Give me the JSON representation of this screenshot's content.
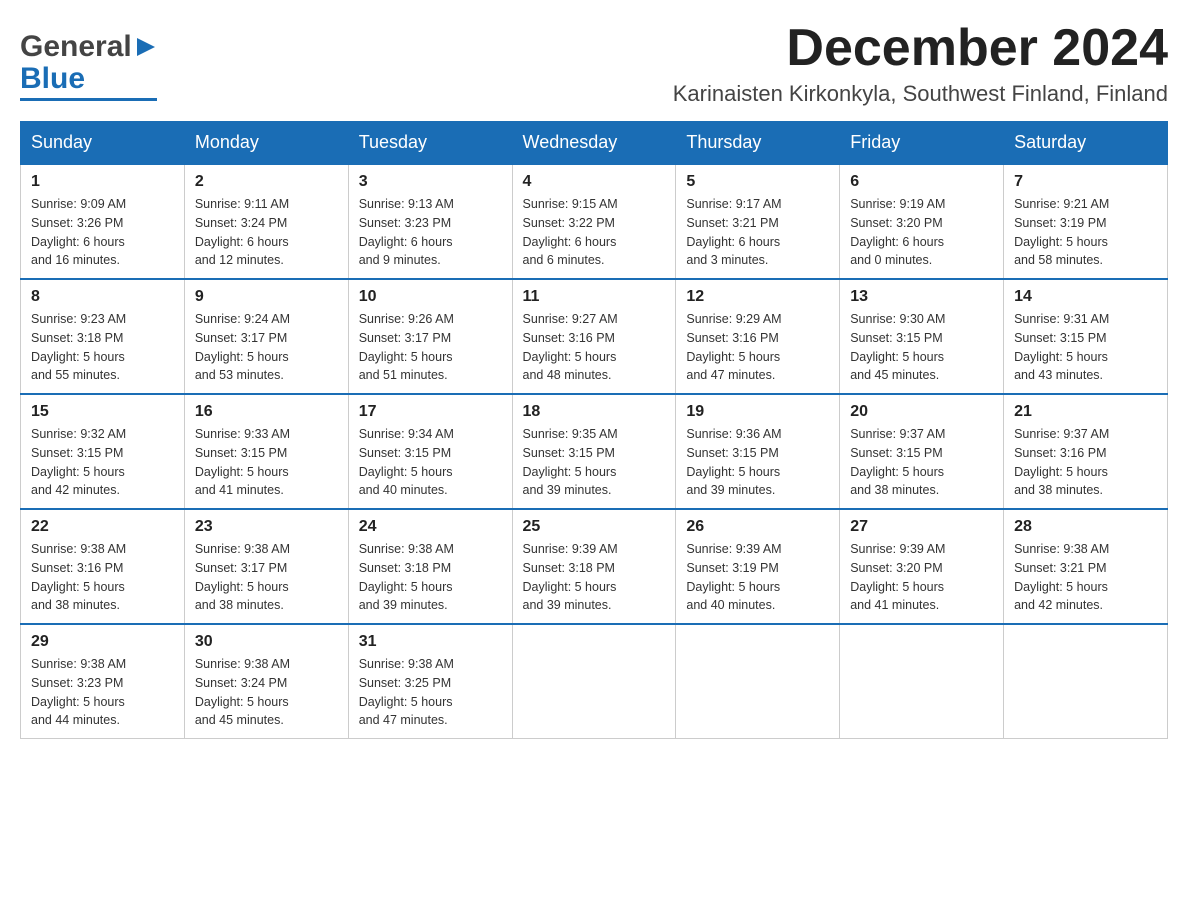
{
  "logo": {
    "general": "General",
    "blue": "Blue"
  },
  "title": "December 2024",
  "subtitle": "Karinaisten Kirkonkyla, Southwest Finland, Finland",
  "headers": [
    "Sunday",
    "Monday",
    "Tuesday",
    "Wednesday",
    "Thursday",
    "Friday",
    "Saturday"
  ],
  "weeks": [
    [
      {
        "day": "1",
        "sunrise": "Sunrise: 9:09 AM",
        "sunset": "Sunset: 3:26 PM",
        "daylight": "Daylight: 6 hours",
        "minutes": "and 16 minutes."
      },
      {
        "day": "2",
        "sunrise": "Sunrise: 9:11 AM",
        "sunset": "Sunset: 3:24 PM",
        "daylight": "Daylight: 6 hours",
        "minutes": "and 12 minutes."
      },
      {
        "day": "3",
        "sunrise": "Sunrise: 9:13 AM",
        "sunset": "Sunset: 3:23 PM",
        "daylight": "Daylight: 6 hours",
        "minutes": "and 9 minutes."
      },
      {
        "day": "4",
        "sunrise": "Sunrise: 9:15 AM",
        "sunset": "Sunset: 3:22 PM",
        "daylight": "Daylight: 6 hours",
        "minutes": "and 6 minutes."
      },
      {
        "day": "5",
        "sunrise": "Sunrise: 9:17 AM",
        "sunset": "Sunset: 3:21 PM",
        "daylight": "Daylight: 6 hours",
        "minutes": "and 3 minutes."
      },
      {
        "day": "6",
        "sunrise": "Sunrise: 9:19 AM",
        "sunset": "Sunset: 3:20 PM",
        "daylight": "Daylight: 6 hours",
        "minutes": "and 0 minutes."
      },
      {
        "day": "7",
        "sunrise": "Sunrise: 9:21 AM",
        "sunset": "Sunset: 3:19 PM",
        "daylight": "Daylight: 5 hours",
        "minutes": "and 58 minutes."
      }
    ],
    [
      {
        "day": "8",
        "sunrise": "Sunrise: 9:23 AM",
        "sunset": "Sunset: 3:18 PM",
        "daylight": "Daylight: 5 hours",
        "minutes": "and 55 minutes."
      },
      {
        "day": "9",
        "sunrise": "Sunrise: 9:24 AM",
        "sunset": "Sunset: 3:17 PM",
        "daylight": "Daylight: 5 hours",
        "minutes": "and 53 minutes."
      },
      {
        "day": "10",
        "sunrise": "Sunrise: 9:26 AM",
        "sunset": "Sunset: 3:17 PM",
        "daylight": "Daylight: 5 hours",
        "minutes": "and 51 minutes."
      },
      {
        "day": "11",
        "sunrise": "Sunrise: 9:27 AM",
        "sunset": "Sunset: 3:16 PM",
        "daylight": "Daylight: 5 hours",
        "minutes": "and 48 minutes."
      },
      {
        "day": "12",
        "sunrise": "Sunrise: 9:29 AM",
        "sunset": "Sunset: 3:16 PM",
        "daylight": "Daylight: 5 hours",
        "minutes": "and 47 minutes."
      },
      {
        "day": "13",
        "sunrise": "Sunrise: 9:30 AM",
        "sunset": "Sunset: 3:15 PM",
        "daylight": "Daylight: 5 hours",
        "minutes": "and 45 minutes."
      },
      {
        "day": "14",
        "sunrise": "Sunrise: 9:31 AM",
        "sunset": "Sunset: 3:15 PM",
        "daylight": "Daylight: 5 hours",
        "minutes": "and 43 minutes."
      }
    ],
    [
      {
        "day": "15",
        "sunrise": "Sunrise: 9:32 AM",
        "sunset": "Sunset: 3:15 PM",
        "daylight": "Daylight: 5 hours",
        "minutes": "and 42 minutes."
      },
      {
        "day": "16",
        "sunrise": "Sunrise: 9:33 AM",
        "sunset": "Sunset: 3:15 PM",
        "daylight": "Daylight: 5 hours",
        "minutes": "and 41 minutes."
      },
      {
        "day": "17",
        "sunrise": "Sunrise: 9:34 AM",
        "sunset": "Sunset: 3:15 PM",
        "daylight": "Daylight: 5 hours",
        "minutes": "and 40 minutes."
      },
      {
        "day": "18",
        "sunrise": "Sunrise: 9:35 AM",
        "sunset": "Sunset: 3:15 PM",
        "daylight": "Daylight: 5 hours",
        "minutes": "and 39 minutes."
      },
      {
        "day": "19",
        "sunrise": "Sunrise: 9:36 AM",
        "sunset": "Sunset: 3:15 PM",
        "daylight": "Daylight: 5 hours",
        "minutes": "and 39 minutes."
      },
      {
        "day": "20",
        "sunrise": "Sunrise: 9:37 AM",
        "sunset": "Sunset: 3:15 PM",
        "daylight": "Daylight: 5 hours",
        "minutes": "and 38 minutes."
      },
      {
        "day": "21",
        "sunrise": "Sunrise: 9:37 AM",
        "sunset": "Sunset: 3:16 PM",
        "daylight": "Daylight: 5 hours",
        "minutes": "and 38 minutes."
      }
    ],
    [
      {
        "day": "22",
        "sunrise": "Sunrise: 9:38 AM",
        "sunset": "Sunset: 3:16 PM",
        "daylight": "Daylight: 5 hours",
        "minutes": "and 38 minutes."
      },
      {
        "day": "23",
        "sunrise": "Sunrise: 9:38 AM",
        "sunset": "Sunset: 3:17 PM",
        "daylight": "Daylight: 5 hours",
        "minutes": "and 38 minutes."
      },
      {
        "day": "24",
        "sunrise": "Sunrise: 9:38 AM",
        "sunset": "Sunset: 3:18 PM",
        "daylight": "Daylight: 5 hours",
        "minutes": "and 39 minutes."
      },
      {
        "day": "25",
        "sunrise": "Sunrise: 9:39 AM",
        "sunset": "Sunset: 3:18 PM",
        "daylight": "Daylight: 5 hours",
        "minutes": "and 39 minutes."
      },
      {
        "day": "26",
        "sunrise": "Sunrise: 9:39 AM",
        "sunset": "Sunset: 3:19 PM",
        "daylight": "Daylight: 5 hours",
        "minutes": "and 40 minutes."
      },
      {
        "day": "27",
        "sunrise": "Sunrise: 9:39 AM",
        "sunset": "Sunset: 3:20 PM",
        "daylight": "Daylight: 5 hours",
        "minutes": "and 41 minutes."
      },
      {
        "day": "28",
        "sunrise": "Sunrise: 9:38 AM",
        "sunset": "Sunset: 3:21 PM",
        "daylight": "Daylight: 5 hours",
        "minutes": "and 42 minutes."
      }
    ],
    [
      {
        "day": "29",
        "sunrise": "Sunrise: 9:38 AM",
        "sunset": "Sunset: 3:23 PM",
        "daylight": "Daylight: 5 hours",
        "minutes": "and 44 minutes."
      },
      {
        "day": "30",
        "sunrise": "Sunrise: 9:38 AM",
        "sunset": "Sunset: 3:24 PM",
        "daylight": "Daylight: 5 hours",
        "minutes": "and 45 minutes."
      },
      {
        "day": "31",
        "sunrise": "Sunrise: 9:38 AM",
        "sunset": "Sunset: 3:25 PM",
        "daylight": "Daylight: 5 hours",
        "minutes": "and 47 minutes."
      },
      null,
      null,
      null,
      null
    ]
  ]
}
